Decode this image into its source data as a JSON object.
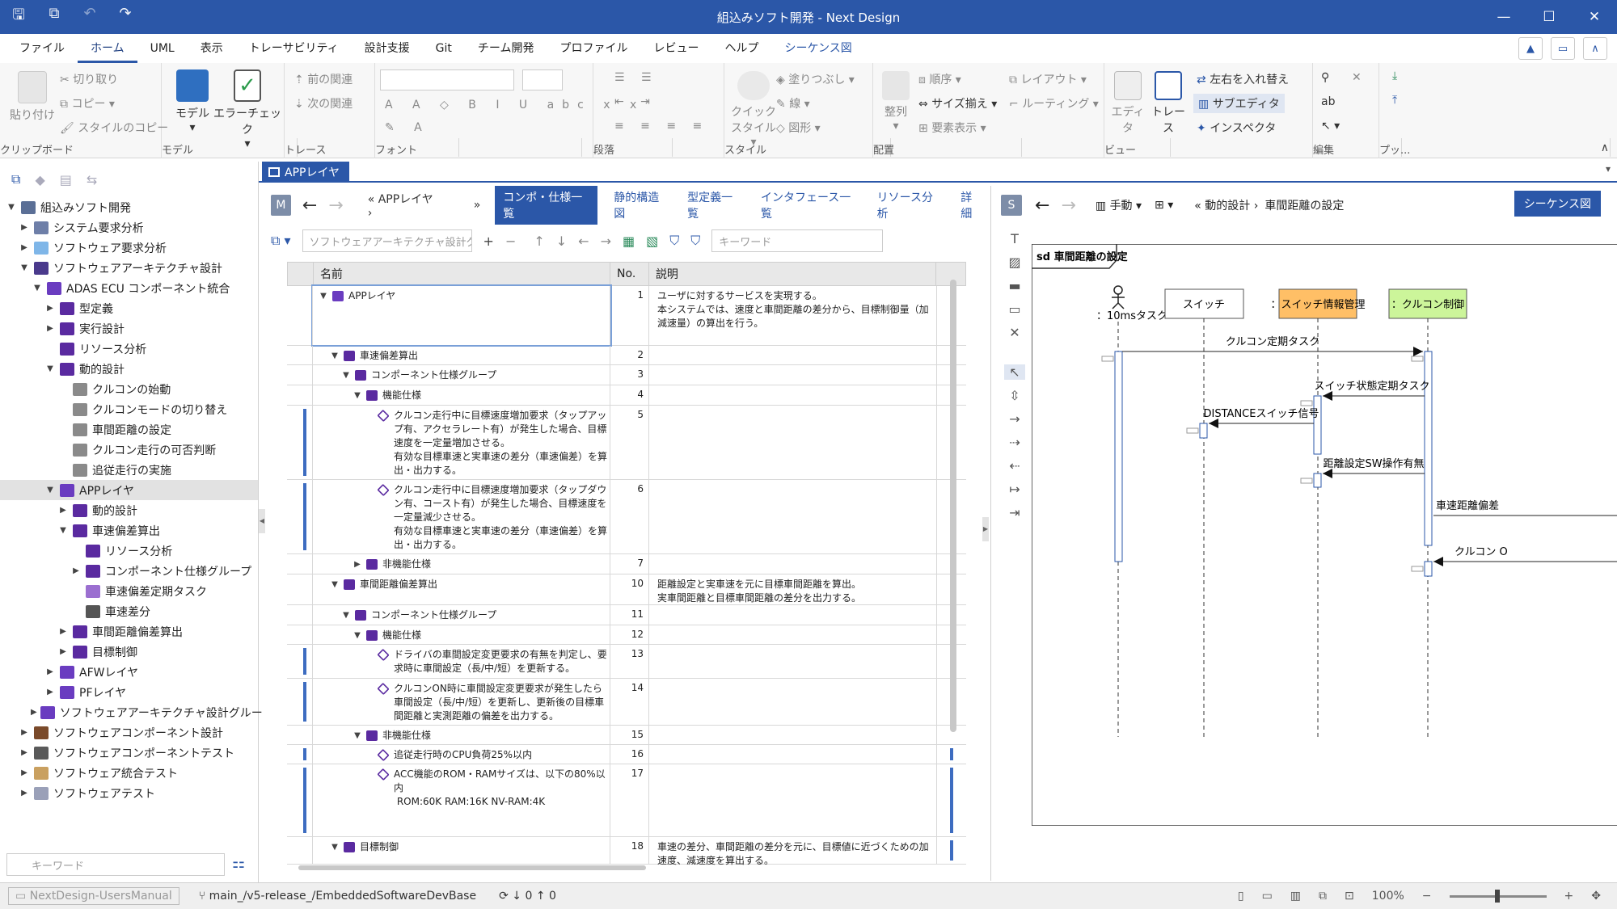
{
  "window": {
    "title": "組込みソフト開発 - Next Design"
  },
  "menu": {
    "items": [
      "ファイル",
      "ホーム",
      "UML",
      "表示",
      "トレーサビリティ",
      "設計支援",
      "Git",
      "チーム開発",
      "プロファイル",
      "レビュー",
      "ヘルプ",
      "シーケンス図"
    ],
    "active": "ホーム"
  },
  "ribbon": {
    "clipboard": {
      "name": "クリップボード",
      "paste": "貼り付け",
      "cut": "切り取り",
      "copy": "コピー",
      "style_copy": "スタイルのコピー"
    },
    "model": {
      "name": "モデル",
      "model_btn": "モデル",
      "error_check": "エラーチェック"
    },
    "trace": {
      "name": "トレース",
      "prev": "前の関連",
      "next": "次の関連"
    },
    "font": {
      "name": "フォント"
    },
    "paragraph": {
      "name": "段落"
    },
    "style": {
      "name": "スタイル",
      "quick": "クイック",
      "quick2": "スタイル",
      "fill": "塗りつぶし",
      "line": "線",
      "shape": "図形"
    },
    "arrange": {
      "name": "配置",
      "align": "整列",
      "order": "順序",
      "size": "サイズ揃え",
      "show": "要素表示",
      "layout": "レイアウト",
      "routing": "ルーティング"
    },
    "view": {
      "name": "ビュー",
      "editor": "エディタ",
      "trace": "トレース",
      "swap": "左右を入れ替え",
      "sub_editor": "サブエディタ",
      "inspector": "インスペクタ"
    },
    "edit": {
      "name": "編集"
    },
    "publish": {
      "name": "プッ..."
    }
  },
  "explorer": {
    "search_placeholder": "キーワード",
    "tree": [
      {
        "depth": 0,
        "toggle": "▼",
        "label": "組込みソフト開発",
        "color": "#5b6f96"
      },
      {
        "depth": 1,
        "toggle": "▶",
        "label": "システム要求分析",
        "color": "#6e7fa8"
      },
      {
        "depth": 1,
        "toggle": "▶",
        "label": "ソフトウェア要求分析",
        "color": "#7fb6e8"
      },
      {
        "depth": 1,
        "toggle": "▼",
        "label": "ソフトウェアアーキテクチャ設計",
        "color": "#4a3a8c"
      },
      {
        "depth": 2,
        "toggle": "▼",
        "label": "ADAS ECU コンポーネント統合",
        "color": "#6a3cc0"
      },
      {
        "depth": 3,
        "toggle": "▶",
        "label": "型定義",
        "color": "#5a2aa0"
      },
      {
        "depth": 3,
        "toggle": "▶",
        "label": "実行設計",
        "color": "#5a2aa0"
      },
      {
        "depth": 3,
        "toggle": "",
        "label": "リソース分析",
        "color": "#5a2aa0"
      },
      {
        "depth": 3,
        "toggle": "▼",
        "label": "動的設計",
        "color": "#5a2aa0"
      },
      {
        "depth": 4,
        "toggle": "",
        "label": "クルコンの始動",
        "color": "#8a8a8a"
      },
      {
        "depth": 4,
        "toggle": "",
        "label": "クルコンモードの切り替え",
        "color": "#8a8a8a"
      },
      {
        "depth": 4,
        "toggle": "",
        "label": "車間距離の設定",
        "color": "#8a8a8a"
      },
      {
        "depth": 4,
        "toggle": "",
        "label": "クルコン走行の可否判断",
        "color": "#8a8a8a"
      },
      {
        "depth": 4,
        "toggle": "",
        "label": "追従走行の実施",
        "color": "#8a8a8a"
      },
      {
        "depth": 3,
        "toggle": "▼",
        "label": "APPレイヤ",
        "color": "#6a3cc0",
        "selected": true
      },
      {
        "depth": 4,
        "toggle": "▶",
        "label": "動的設計",
        "color": "#5a2aa0"
      },
      {
        "depth": 4,
        "toggle": "▼",
        "label": "車速偏差算出",
        "color": "#5a2aa0"
      },
      {
        "depth": 5,
        "toggle": "",
        "label": "リソース分析",
        "color": "#5a2aa0"
      },
      {
        "depth": 5,
        "toggle": "▶",
        "label": "コンポーネント仕様グループ",
        "color": "#5a2aa0"
      },
      {
        "depth": 5,
        "toggle": "",
        "label": "車速偏差定期タスク",
        "color": "#9b6fd0"
      },
      {
        "depth": 5,
        "toggle": "",
        "label": "車速差分",
        "color": "#555555"
      },
      {
        "depth": 4,
        "toggle": "▶",
        "label": "車間距離偏差算出",
        "color": "#5a2aa0"
      },
      {
        "depth": 4,
        "toggle": "▶",
        "label": "目標制御",
        "color": "#5a2aa0"
      },
      {
        "depth": 3,
        "toggle": "▶",
        "label": "AFWレイヤ",
        "color": "#6a3cc0"
      },
      {
        "depth": 3,
        "toggle": "▶",
        "label": "PFレイヤ",
        "color": "#6a3cc0"
      },
      {
        "depth": 2,
        "toggle": "▶",
        "label": "ソフトウェアアーキテクチャ設計グループ",
        "color": "#6a3cc0"
      },
      {
        "depth": 1,
        "toggle": "▶",
        "label": "ソフトウェアコンポーネント設計",
        "color": "#7a4a2a"
      },
      {
        "depth": 1,
        "toggle": "▶",
        "label": "ソフトウェアコンポーネントテスト",
        "color": "#5a5a5a"
      },
      {
        "depth": 1,
        "toggle": "▶",
        "label": "ソフトウェア統合テスト",
        "color": "#c9a060"
      },
      {
        "depth": 1,
        "toggle": "▶",
        "label": "ソフトウェアテスト",
        "color": "#9aa0b8"
      }
    ]
  },
  "doc_tab": {
    "label": "APPレイヤ"
  },
  "center": {
    "badge": "M",
    "breadcrumb": "« APPレイヤ ›",
    "more": "»",
    "views": [
      "コンポ・仕様一覧",
      "静的構造図",
      "型定義一覧",
      "インタフェース一覧",
      "リソース分析",
      "詳細"
    ],
    "active_view": "コンポ・仕様一覧",
    "combo_placeholder": "ソフトウェアアーキテクチャ設計グル..",
    "keyword_placeholder": "キーワード",
    "columns": {
      "name": "名前",
      "no": "No.",
      "desc": "説明"
    },
    "rows": [
      {
        "indent": 0,
        "toggle": "▼",
        "icon": "#6a3cc0",
        "name": "APPレイヤ",
        "no": "1",
        "desc": "ユーザに対するサービスを実現する。\n本システムでは、速度と車間距離の差分から、目標制御量（加減速量）の算出を行う。",
        "h": 74,
        "selected": true,
        "markL": false,
        "markR": false
      },
      {
        "indent": 1,
        "toggle": "▼",
        "icon": "#5a2aa0",
        "name": "車速偏差算出",
        "no": "2",
        "desc": "",
        "h": 24,
        "markL": false,
        "markR": true
      },
      {
        "indent": 2,
        "toggle": "▼",
        "icon": "#5a2aa0",
        "name": "コンポーネント仕様グループ",
        "no": "3",
        "desc": "",
        "h": 25,
        "markL": false,
        "markR": false
      },
      {
        "indent": 3,
        "toggle": "▼",
        "icon": "#5a2aa0",
        "name": "機能仕様",
        "no": "4",
        "desc": "",
        "h": 25,
        "markL": false,
        "markR": false
      },
      {
        "indent": 4,
        "toggle": "",
        "icon": "#5a2aa0",
        "tag": true,
        "name": "クルコン走行中に目標速度増加要求（タップアップ有、アクセラレート有）が発生した場合、目標速度を一定量増加させる。\n有効な目標車速と実車速の差分（車速偏差）を算出・出力する。",
        "no": "5",
        "desc": "",
        "h": 92,
        "markL": true,
        "markR": true
      },
      {
        "indent": 4,
        "toggle": "",
        "icon": "#5a2aa0",
        "tag": true,
        "name": "クルコン走行中に目標速度増加要求（タップダウン有、コースト有）が発生した場合、目標速度を一定量減少させる。\n有効な目標車速と実車速の差分（車速偏差）を算出・出力する。",
        "no": "6",
        "desc": "",
        "h": 92,
        "markL": true,
        "markR": true
      },
      {
        "indent": 3,
        "toggle": "▶",
        "icon": "#5a2aa0",
        "name": "非機能仕様",
        "no": "7",
        "desc": "",
        "h": 25,
        "markL": false,
        "markR": false
      },
      {
        "indent": 1,
        "toggle": "▼",
        "icon": "#5a2aa0",
        "name": "車間距離偏差算出",
        "no": "10",
        "desc": "距離設定と実車速を元に目標車間距離を算出。\n実車間距離と目標車間距離の差分を出力する。",
        "h": 38,
        "markL": false,
        "markR": true
      },
      {
        "indent": 2,
        "toggle": "▼",
        "icon": "#5a2aa0",
        "name": "コンポーネント仕様グループ",
        "no": "11",
        "desc": "",
        "h": 25,
        "markL": false,
        "markR": false
      },
      {
        "indent": 3,
        "toggle": "▼",
        "icon": "#5a2aa0",
        "name": "機能仕様",
        "no": "12",
        "desc": "",
        "h": 24,
        "markL": false,
        "markR": false
      },
      {
        "indent": 4,
        "toggle": "",
        "icon": "#5a2aa0",
        "tag": true,
        "name": "ドライバの車間設定変更要求の有無を判定し、要求時に車間設定（長/中/短）を更新する。",
        "no": "13",
        "desc": "",
        "h": 42,
        "markL": true,
        "markR": true
      },
      {
        "indent": 4,
        "toggle": "",
        "icon": "#5a2aa0",
        "tag": true,
        "name": "クルコンON時に車間設定変更要求が発生したら車間設定（長/中/短）を更新し、更新後の目標車間距離と実測距離の偏差を出力する。",
        "no": "14",
        "desc": "",
        "h": 58,
        "markL": true,
        "markR": true
      },
      {
        "indent": 3,
        "toggle": "▼",
        "icon": "#5a2aa0",
        "name": "非機能仕様",
        "no": "15",
        "desc": "",
        "h": 24,
        "markL": false,
        "markR": false
      },
      {
        "indent": 4,
        "toggle": "",
        "icon": "#5a2aa0",
        "tag": true,
        "name": "追従走行時のCPU負荷25%以内",
        "no": "16",
        "desc": "",
        "h": 24,
        "markL": true,
        "markR": true
      },
      {
        "indent": 4,
        "toggle": "",
        "icon": "#5a2aa0",
        "tag": true,
        "name": "ACC機能のROM・RAMサイズは、以下の80%以内\n ROM:60K RAM:16K NV-RAM:4K",
        "no": "17",
        "desc": "",
        "h": 90,
        "markL": true,
        "markR": true
      },
      {
        "indent": 1,
        "toggle": "▼",
        "icon": "#5a2aa0",
        "name": "目標制御",
        "no": "18",
        "desc": "車速の差分、車間距離の差分を元に、目標値に近づくための加速度、減速度を算出する。",
        "h": 34,
        "markL": false,
        "markR": true
      }
    ]
  },
  "right": {
    "badge": "S",
    "mode": "手動",
    "breadcrumb_parent": "« 動的設計 ›",
    "breadcrumb_current": "車間距離の設定",
    "type_button": "シーケンス図",
    "frame_label": "sd  車間距離の設定",
    "lifelines": {
      "actor": "：10msタスク",
      "switch": "スイッチ",
      "switch_info": "：スイッチ情報管理",
      "cruise": "：クルコン制御"
    },
    "colors": {
      "switch_info": "#ffbf66",
      "cruise": "#ccf59a"
    },
    "messages": {
      "m1": "クルコン定期タスク",
      "m2": "スイッチ状態定期タスク",
      "m3": "DISTANCEスイッチ信号",
      "m4": "距離設定SW操作有無",
      "m5": "車速距離偏差",
      "m6": "クルコン O"
    }
  },
  "status": {
    "project": "NextDesign-UsersManual",
    "branch": "main_/v5-release_/EmbeddedSoftwareDevBase",
    "sync": "↓ 0 ↑ 0",
    "zoom": "100%"
  },
  "accent": "#2b57a8"
}
